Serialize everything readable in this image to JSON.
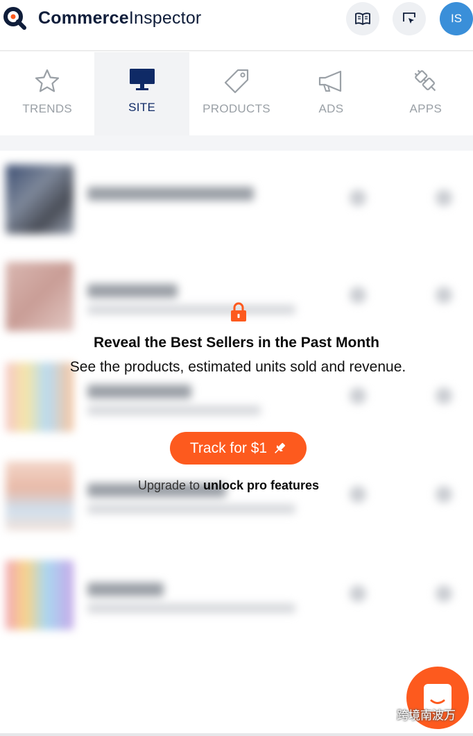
{
  "header": {
    "brand_bold": "Commerce",
    "brand_regular": "Inspector",
    "icons": [
      "book-icon",
      "cursor-select-icon"
    ],
    "avatar_initials": "IS"
  },
  "tabs": [
    {
      "label": "TRENDS",
      "icon": "star-icon",
      "active": false
    },
    {
      "label": "SITE",
      "icon": "monitor-icon",
      "active": true
    },
    {
      "label": "PRODUCTS",
      "icon": "tag-icon",
      "active": false
    },
    {
      "label": "ADS",
      "icon": "megaphone-icon",
      "active": false
    },
    {
      "label": "APPS",
      "icon": "plug-icon",
      "active": false
    }
  ],
  "overlay": {
    "headline": "Reveal the Best Sellers in the Past Month",
    "description": "See the products, estimated units sold and revenue.",
    "cta_label": "Track for $1",
    "upgrade_prefix": "Upgrade to ",
    "upgrade_bold": "unlock pro features"
  },
  "watermark": "跨境南波万",
  "colors": {
    "accent": "#fd5a1e",
    "brand_navy": "#0f1d3a",
    "active_tab": "#0f2a66",
    "avatar": "#3a8fd9"
  }
}
